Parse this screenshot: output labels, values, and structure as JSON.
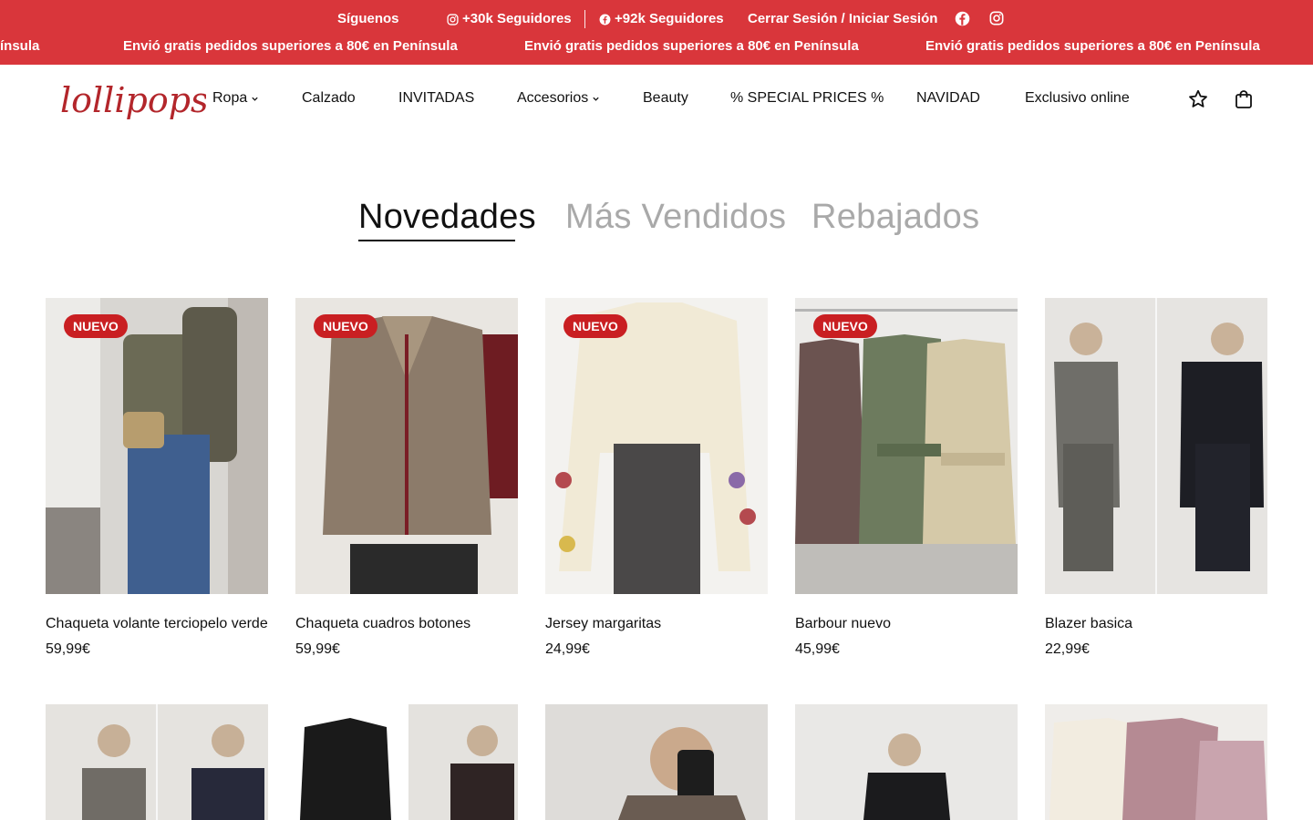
{
  "topbar": {
    "follow_label": "Síguenos",
    "instagram_followers": "+30k Seguidores",
    "facebook_followers": "+92k Seguidores",
    "account_link": "Cerrar Sesión / Iniciar Sesión",
    "promo_partial": "ínsula",
    "promo_text": "Envió gratis pedidos superiores a 80€ en Península",
    "bg_color": "#d9363b"
  },
  "header": {
    "logo_text": "lollipops",
    "nav": [
      {
        "label": "Ropa",
        "has_dropdown": true
      },
      {
        "label": "Calzado",
        "has_dropdown": false
      },
      {
        "label": "INVITADAS",
        "has_dropdown": false
      },
      {
        "label": "Accesorios",
        "has_dropdown": true
      },
      {
        "label": "Beauty",
        "has_dropdown": false
      },
      {
        "label": "% SPECIAL PRICES %",
        "has_dropdown": false
      },
      {
        "label": "NAVIDAD",
        "has_dropdown": false
      },
      {
        "label": "Exclusivo online",
        "has_dropdown": false
      }
    ],
    "icons": [
      "star-icon",
      "shopping-bag-icon"
    ]
  },
  "tabs": [
    {
      "label": "Novedades",
      "active": true
    },
    {
      "label": "Más Vendidos",
      "active": false
    },
    {
      "label": "Rebajados",
      "active": false
    }
  ],
  "products": [
    {
      "name": "Chaqueta volante terciopelo verde",
      "price": "59,99€",
      "badge": "NUEVO"
    },
    {
      "name": "Chaqueta cuadros botones",
      "price": "59,99€",
      "badge": "NUEVO"
    },
    {
      "name": "Jersey margaritas",
      "price": "24,99€",
      "badge": "NUEVO"
    },
    {
      "name": "Barbour nuevo",
      "price": "45,99€",
      "badge": "NUEVO"
    },
    {
      "name": "Blazer basica",
      "price": "22,99€",
      "badge": ""
    }
  ],
  "colors": {
    "accent": "#d9363b",
    "badge": "#c91f22",
    "text": "#111111",
    "inactive_tab": "#a9a9a9"
  }
}
